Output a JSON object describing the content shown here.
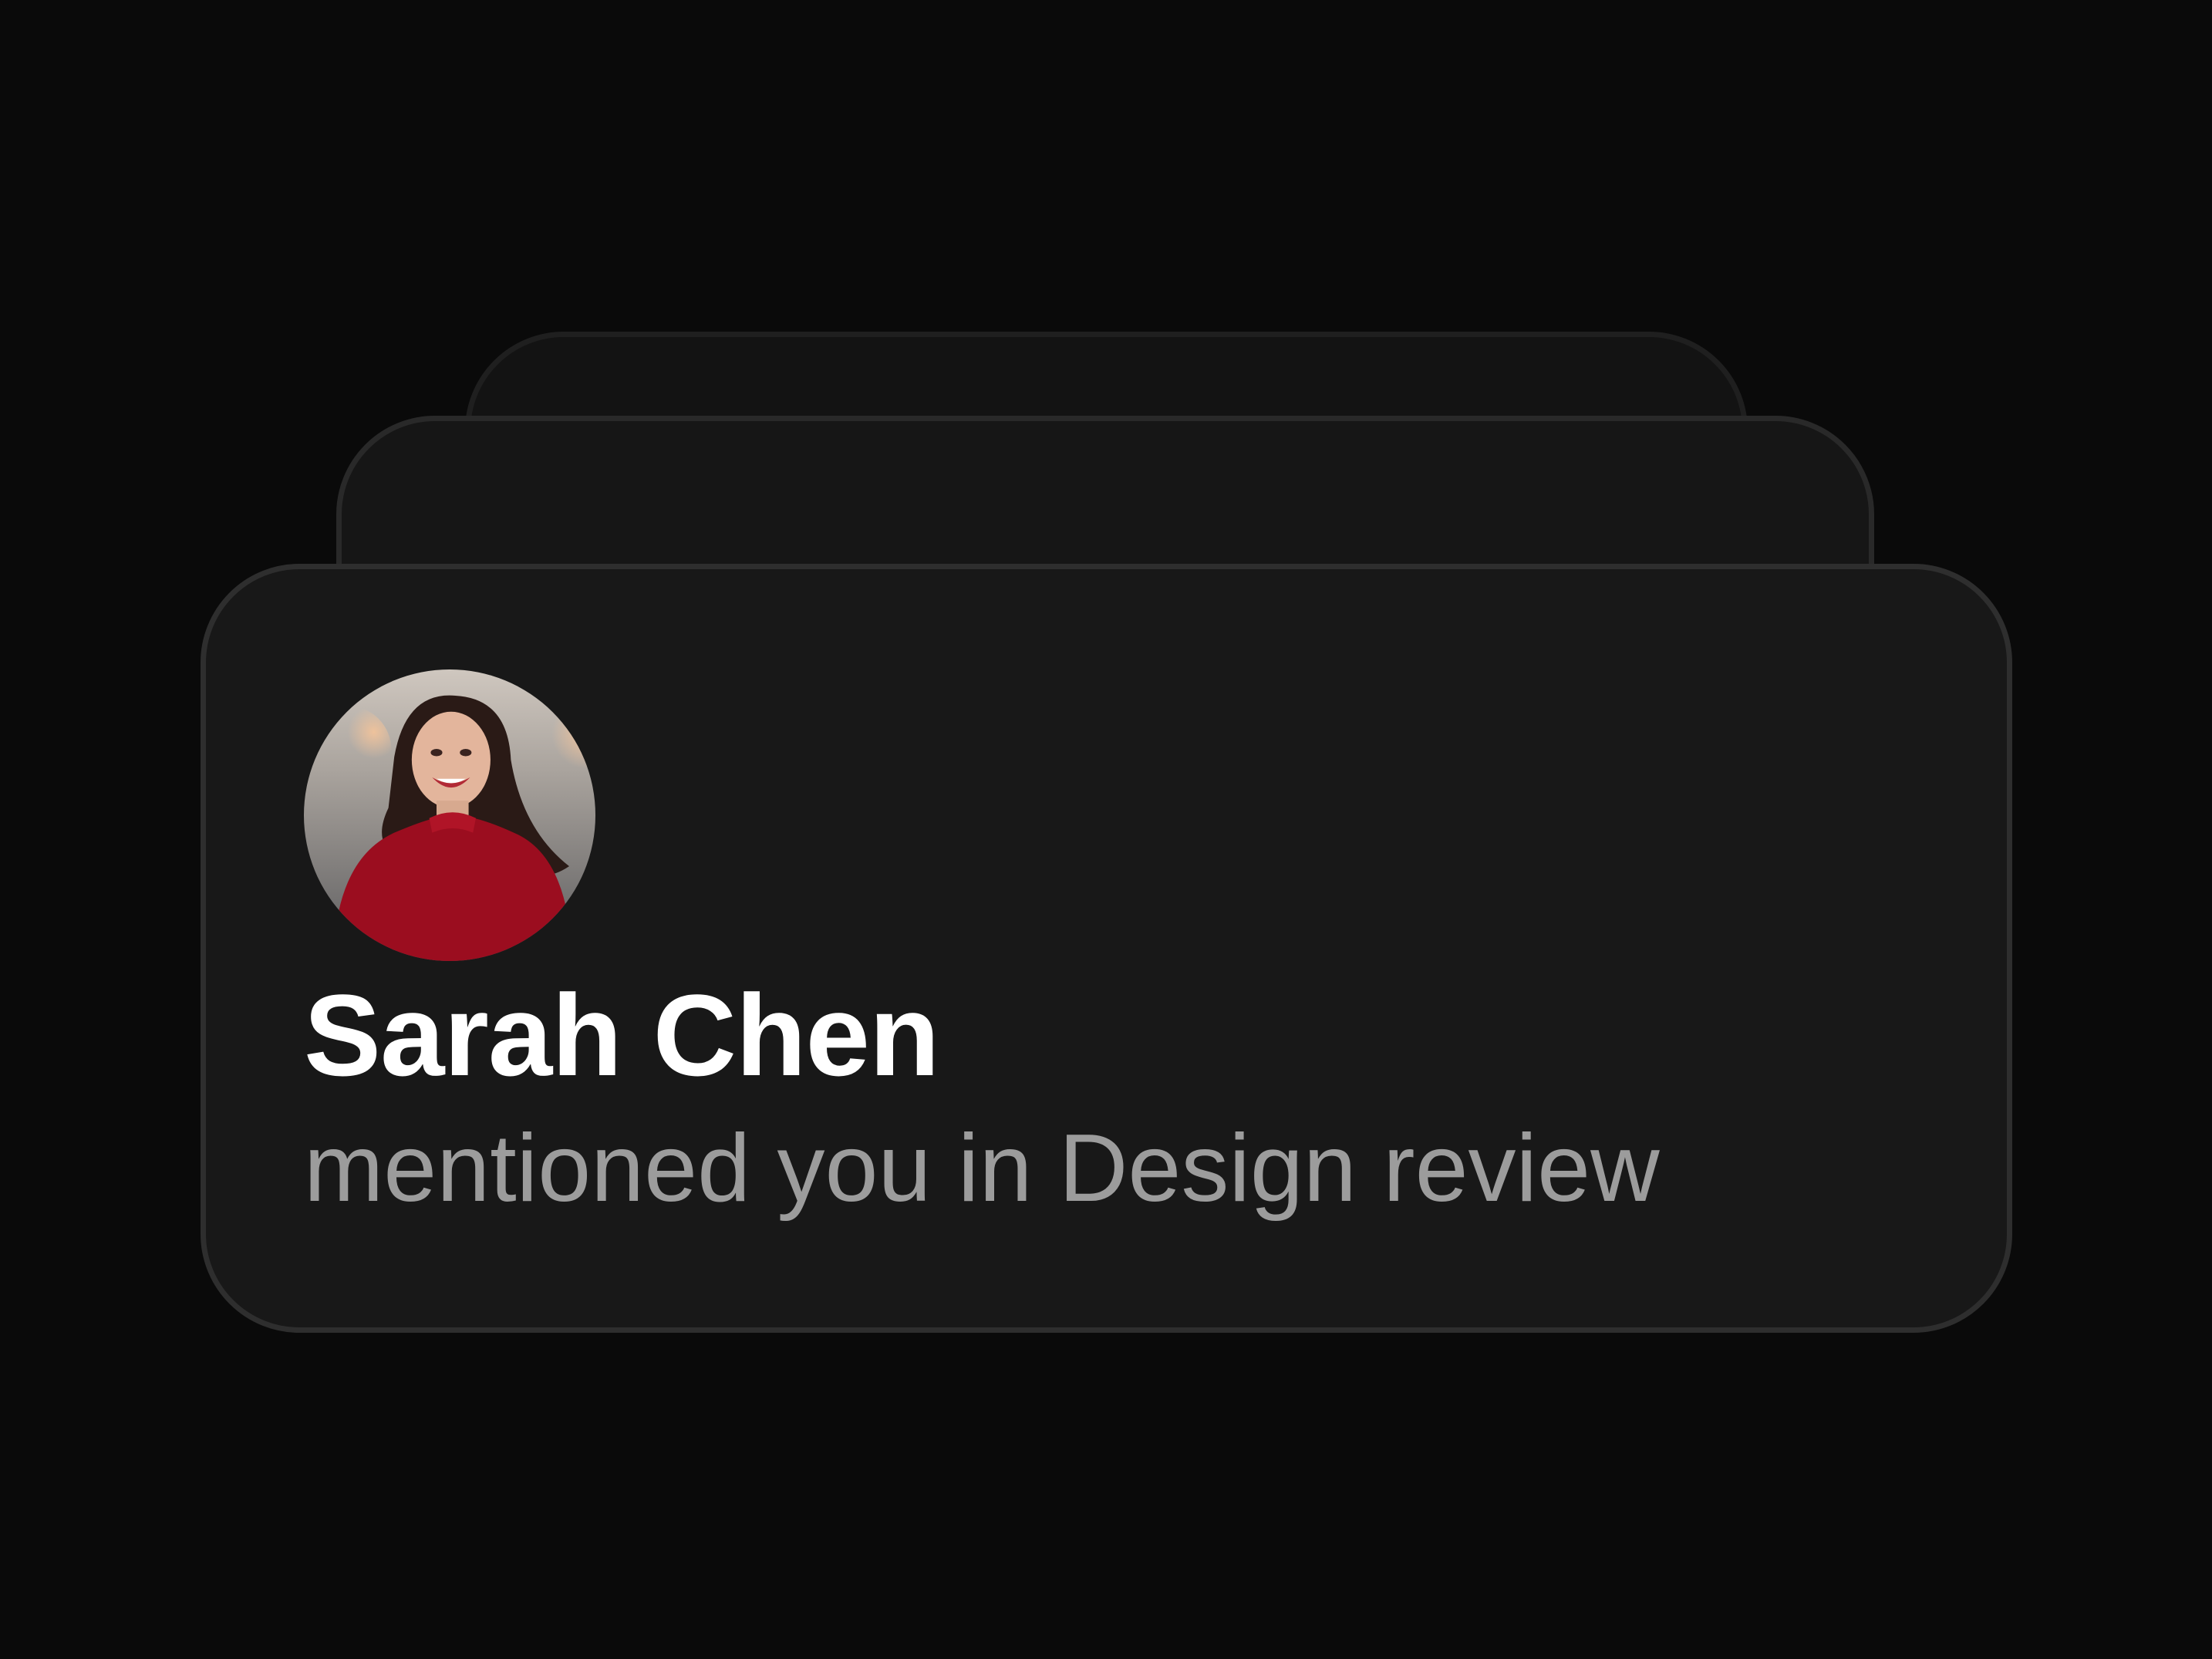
{
  "notification": {
    "sender_name": "Sarah Chen",
    "message": "mentioned you in Design review",
    "avatar_icon": "avatar-photo"
  },
  "colors": {
    "background": "#0a0a0a",
    "card": "#181818",
    "card_border": "#2e2e2e",
    "name_text": "#ffffff",
    "message_text": "#9c9c9c"
  }
}
